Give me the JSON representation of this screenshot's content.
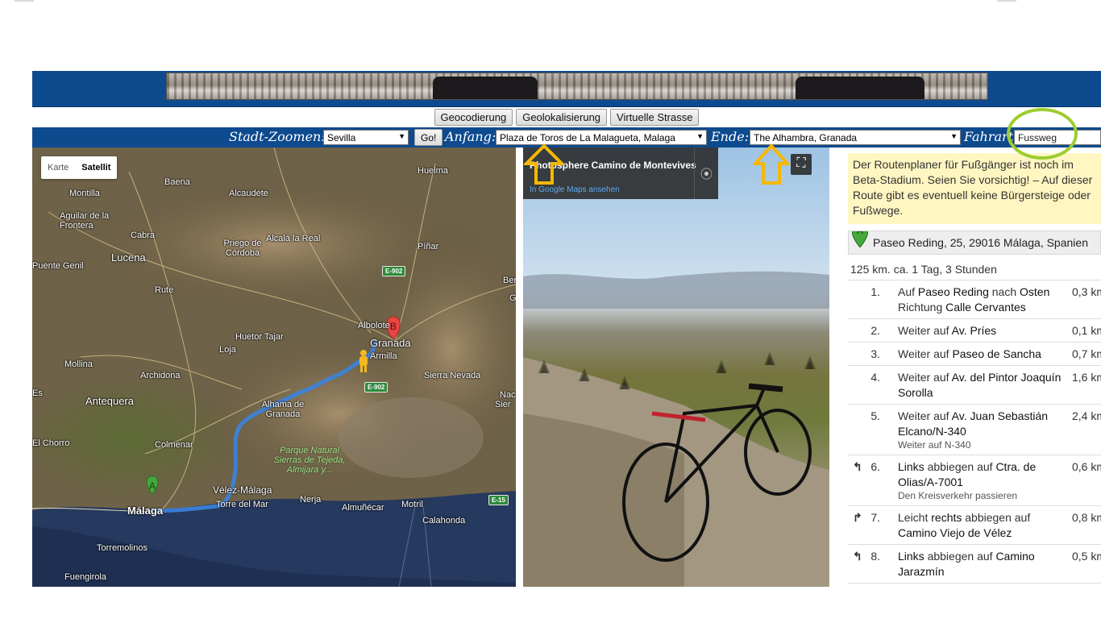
{
  "banner": {
    "alt": "banner-photo"
  },
  "buttons": {
    "geocode": "Geocodierung",
    "geolocate": "Geolokalisierung",
    "virtual_street": "Virtuelle Strasse"
  },
  "controls": {
    "city_zoom_label": "Stadt-Zoomen:",
    "city_value": "Sevilla",
    "go": "Go!",
    "start_label": "Anfang:",
    "start_value": "Plaza de Toros de La Malagueta, Malaga",
    "end_label": "Ende:",
    "end_value": "The Alhambra, Granada",
    "travel_mode_label": "Fahrart:",
    "travel_mode_value": "Fussweg"
  },
  "map": {
    "toggle": {
      "map": "Karte",
      "satellite": "Satellit"
    },
    "places": [
      "Baena",
      "Huelma",
      "Montilla",
      "Alcaudete",
      "Aguilar de la Frontera",
      "Cabra",
      "Priego de Córdoba",
      "Alcalá la Real",
      "Píñar",
      "Puente Genil",
      "Lucena",
      "Rute",
      "Albolote",
      "Granada",
      "Armilla",
      "Huetor Tajar",
      "Loja",
      "Mollina",
      "Archidona",
      "Sierra Nevada",
      "Antequera",
      "Alhama de Granada",
      "El Chorro",
      "Colmenar",
      "Vélez-Málaga",
      "Torre del Mar",
      "Nerja",
      "Almuñécar",
      "Motril",
      "Calahonda",
      "Málaga",
      "Torremolinos",
      "Fuengirola",
      "Ben",
      "G",
      "Nac",
      "Sier",
      "Es"
    ],
    "park": "Parque Natural Sierras de Tejeda, Almijara y...",
    "roads": [
      "E-902",
      "E-902",
      "E-15"
    ],
    "markers": {
      "a": "A",
      "b": "B"
    }
  },
  "streetview": {
    "title": "Photosphere Camino de Montevives",
    "link": "In Google Maps ansehen"
  },
  "directions": {
    "warning": "Der Routenplaner für Fußgänger ist noch im Beta-Stadium. Seien Sie vorsichtig! – Auf dieser Route gibt es eventuell keine Bürgersteige oder Fußwege.",
    "start_marker": "A",
    "start_address": "Paseo Reding, 25, 29016 Málaga, Spanien",
    "summary": "125 km. ca. 1 Tag, 3 Stunden",
    "steps": [
      {
        "num": "1.",
        "turn": "",
        "pre": "Auf ",
        "street": "Paseo Reding",
        "mid": " nach ",
        "dir": "Osten",
        "mid2": " Richtung ",
        "target": "Calle Cervantes",
        "note": "",
        "dist": "0,3 km"
      },
      {
        "num": "2.",
        "turn": "",
        "pre": "Weiter auf ",
        "street": "Av. Príes",
        "mid": "",
        "dir": "",
        "mid2": "",
        "target": "",
        "note": "",
        "dist": "0,1 km"
      },
      {
        "num": "3.",
        "turn": "",
        "pre": "Weiter auf ",
        "street": "Paseo de Sancha",
        "mid": "",
        "dir": "",
        "mid2": "",
        "target": "",
        "note": "",
        "dist": "0,7 km"
      },
      {
        "num": "4.",
        "turn": "",
        "pre": "Weiter auf ",
        "street": "Av. del Pintor Joaquín Sorolla",
        "mid": "",
        "dir": "",
        "mid2": "",
        "target": "",
        "note": "",
        "dist": "1,6 km"
      },
      {
        "num": "5.",
        "turn": "",
        "pre": "Weiter auf ",
        "street": "Av. Juan Sebastián Elcano/N-340",
        "mid": "",
        "dir": "",
        "mid2": "",
        "target": "",
        "note": "Weiter auf N-340",
        "dist": "2,4 km"
      },
      {
        "num": "6.",
        "turn": "↰",
        "pre": "",
        "street": "Links",
        "mid": " abbiegen auf ",
        "dir": "Ctra. de Olias/A-7001",
        "mid2": "",
        "target": "",
        "note": "Den Kreisverkehr passieren",
        "dist": "0,6 km"
      },
      {
        "num": "7.",
        "turn": "↱",
        "pre": "Leicht ",
        "street": "rechts",
        "mid": " abbiegen auf ",
        "dir": "Camino Viejo de Vélez",
        "mid2": "",
        "target": "",
        "note": "",
        "dist": "0,8 km"
      },
      {
        "num": "8.",
        "turn": "↰",
        "pre": "",
        "street": "Links",
        "mid": " abbiegen auf ",
        "dir": "Camino Jarazmín",
        "mid2": "",
        "target": "",
        "note": "",
        "dist": "0,5 km"
      }
    ]
  },
  "colors": {
    "banner": "#0d4a8e",
    "annotation_arrow": "#f5b800",
    "annotation_circle": "#9ccd2f",
    "route": "#3b82dc"
  }
}
